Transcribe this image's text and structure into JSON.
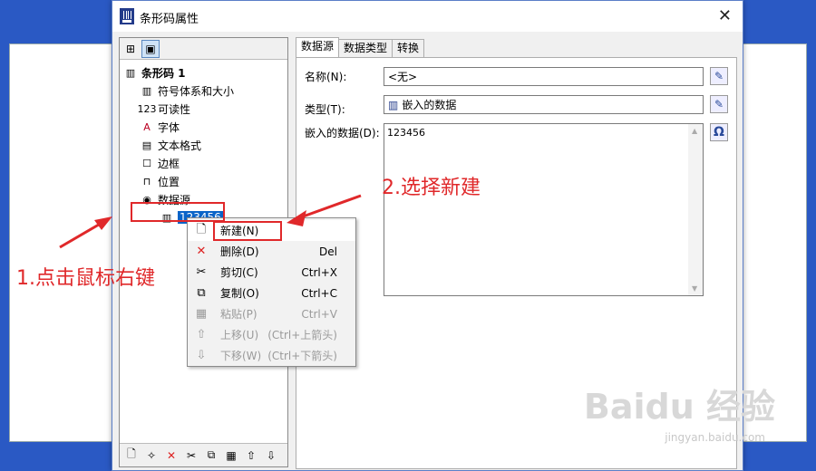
{
  "dialog": {
    "title": "条形码属性",
    "close": "✕"
  },
  "left_toolbar": [
    "tree-view-icon",
    "layout-icon"
  ],
  "tree": {
    "root": "条形码 1",
    "items": [
      "符号体系和大小",
      "可读性",
      "字体",
      "文本格式",
      "边框",
      "位置",
      "数据源"
    ],
    "sub_item": "123456"
  },
  "tabs": [
    "数据源",
    "数据类型",
    "转换"
  ],
  "fields": {
    "name_label": "名称(N):",
    "name_value": "<无>",
    "type_label": "类型(T):",
    "type_value": "嵌入的数据",
    "embedded_label": "嵌入的数据(D):",
    "embedded_value": "123456",
    "omega": "Ω"
  },
  "menu": [
    {
      "label": "新建(N)",
      "shortcut": "",
      "enabled": true
    },
    {
      "label": "删除(D)",
      "shortcut": "Del",
      "enabled": true
    },
    {
      "label": "剪切(C)",
      "shortcut": "Ctrl+X",
      "enabled": true
    },
    {
      "label": "复制(O)",
      "shortcut": "Ctrl+C",
      "enabled": true
    },
    {
      "label": "粘贴(P)",
      "shortcut": "Ctrl+V",
      "enabled": false
    },
    {
      "label": "上移(U)",
      "shortcut": "(Ctrl+上箭头)",
      "enabled": false
    },
    {
      "label": "下移(W)",
      "shortcut": "(Ctrl+下箭头)",
      "enabled": false
    }
  ],
  "annotations": {
    "step1": "1.点击鼠标右键",
    "step2": "2.选择新建"
  },
  "watermark": {
    "main": "Baidu 经验",
    "sub": "jingyan.baidu.com"
  },
  "colors": {
    "selection": "#0a64c8",
    "annotation": "#e0282a"
  }
}
